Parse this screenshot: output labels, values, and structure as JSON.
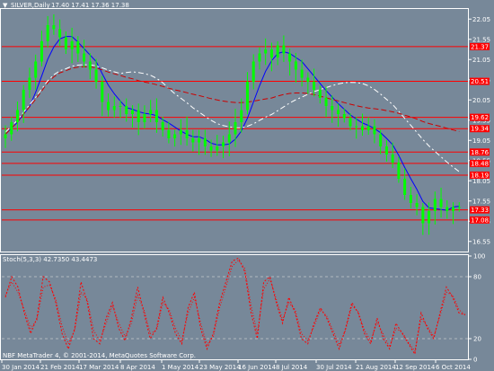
{
  "header": {
    "menu_glyph": "▼",
    "symbol": "SILVER,Daily",
    "ohlc": "17.40 17.41 17.36 17.38"
  },
  "price_axis": {
    "ticks": [
      "22.05",
      "21.55",
      "21.05",
      "20.55",
      "20.05",
      "19.55",
      "19.05",
      "18.55",
      "18.05",
      "17.55",
      "17.05",
      "16.55"
    ]
  },
  "horizontal_levels": [
    {
      "label": "21.37",
      "value": 21.37
    },
    {
      "label": "20.51",
      "value": 20.51
    },
    {
      "label": "19.62",
      "value": 19.62
    },
    {
      "label": "19.34",
      "value": 19.34
    },
    {
      "label": "18.76",
      "value": 18.76
    },
    {
      "label": "18.48",
      "value": 18.48
    },
    {
      "label": "18.19",
      "value": 18.19
    },
    {
      "label": "17.33",
      "value": 17.33
    },
    {
      "label": "17.08",
      "value": 17.08
    }
  ],
  "date_axis": {
    "labels": [
      "30 Jan 2014",
      "21 Feb 2014",
      "17 Mar 2014",
      "8 Apr 2014",
      "1 May 2014",
      "23 May 2014",
      "16 Jun 2014",
      "8 Jul 2014",
      "30 Jul 2014",
      "21 Aug 2014",
      "12 Sep 2014",
      "6 Oct 2014"
    ]
  },
  "stoch": {
    "title": "Stoch(5,3,3) 42.7350 43.4473",
    "axis_ticks": [
      "100",
      "80",
      "20",
      "0"
    ],
    "levels": [
      80,
      20
    ]
  },
  "copyright": "NBF MetaTrader 4, © 2001-2014, MetaQuotes Software Corp.",
  "colors": {
    "background": "#778899",
    "candle": "#00ff00",
    "level_line": "#ff0000",
    "level_tag": "#ff0000",
    "ma_fast": "#0000ff",
    "ma_slow": "#cc0000",
    "ma_mid": "#ffffff",
    "stoch_main": "#ff0000"
  },
  "chart_data": [
    {
      "type": "candlestick",
      "title": "SILVER,Daily",
      "ylim": [
        16.3,
        22.3
      ],
      "x_labels": [
        "30 Jan 2014",
        "21 Feb 2014",
        "17 Mar 2014",
        "8 Apr 2014",
        "1 May 2014",
        "23 May 2014",
        "16 Jun 2014",
        "8 Jul 2014",
        "30 Jul 2014",
        "21 Aug 2014",
        "12 Sep 2014",
        "6 Oct 2014"
      ],
      "close_series": [
        19.2,
        19.5,
        19.8,
        20.3,
        20.6,
        21.0,
        21.5,
        21.9,
        21.8,
        21.6,
        21.3,
        21.5,
        21.2,
        21.0,
        20.8,
        20.5,
        20.0,
        19.8,
        19.9,
        19.9,
        19.7,
        19.8,
        19.5,
        19.7,
        19.8,
        19.5,
        19.3,
        19.1,
        19.2,
        19.3,
        19.1,
        19.0,
        19.1,
        18.9,
        18.8,
        18.9,
        19.0,
        19.2,
        19.5,
        19.8,
        20.5,
        21.0,
        21.2,
        21.3,
        21.1,
        21.4,
        21.2,
        21.0,
        20.8,
        20.6,
        20.5,
        20.3,
        20.1,
        19.9,
        19.8,
        19.7,
        19.6,
        19.4,
        19.4,
        19.3,
        19.4,
        19.2,
        18.9,
        18.7,
        18.5,
        18.1,
        17.7,
        17.5,
        17.4,
        17.0,
        17.3,
        17.6,
        17.4,
        17.3,
        17.4,
        17.4
      ],
      "levels": [
        21.37,
        20.51,
        19.62,
        19.34,
        18.76,
        18.48,
        18.19,
        17.33,
        17.08
      ]
    },
    {
      "type": "line",
      "title": "Stoch(5,3,3) 42.7350 43.4473",
      "ylim": [
        0,
        100
      ],
      "levels": [
        80,
        20
      ],
      "series": [
        {
          "values": [
            60,
            80,
            70,
            45,
            25,
            40,
            80,
            75,
            55,
            25,
            10,
            30,
            75,
            55,
            20,
            15,
            40,
            55,
            30,
            18,
            40,
            70,
            45,
            20,
            30,
            60,
            45,
            25,
            15,
            50,
            65,
            30,
            10,
            25,
            55,
            75,
            95,
            98,
            85,
            45,
            20,
            75,
            80,
            55,
            35,
            60,
            45,
            20,
            15,
            35,
            50,
            40,
            25,
            10,
            30,
            55,
            45,
            25,
            15,
            40,
            20,
            10,
            35,
            25,
            15,
            5,
            45,
            30,
            20,
            45,
            70,
            60,
            45,
            43
          ]
        },
        {
          "values": [
            62,
            75,
            65,
            48,
            30,
            38,
            70,
            72,
            58,
            32,
            15,
            28,
            65,
            58,
            28,
            18,
            35,
            52,
            35,
            22,
            35,
            62,
            48,
            25,
            28,
            55,
            48,
            30,
            18,
            45,
            60,
            35,
            14,
            22,
            50,
            70,
            90,
            96,
            88,
            52,
            25,
            68,
            78,
            58,
            38,
            55,
            48,
            25,
            18,
            32,
            48,
            42,
            28,
            14,
            28,
            52,
            46,
            28,
            18,
            36,
            24,
            12,
            30,
            26,
            16,
            8,
            40,
            32,
            22,
            42,
            65,
            62,
            48,
            43
          ]
        }
      ]
    }
  ]
}
